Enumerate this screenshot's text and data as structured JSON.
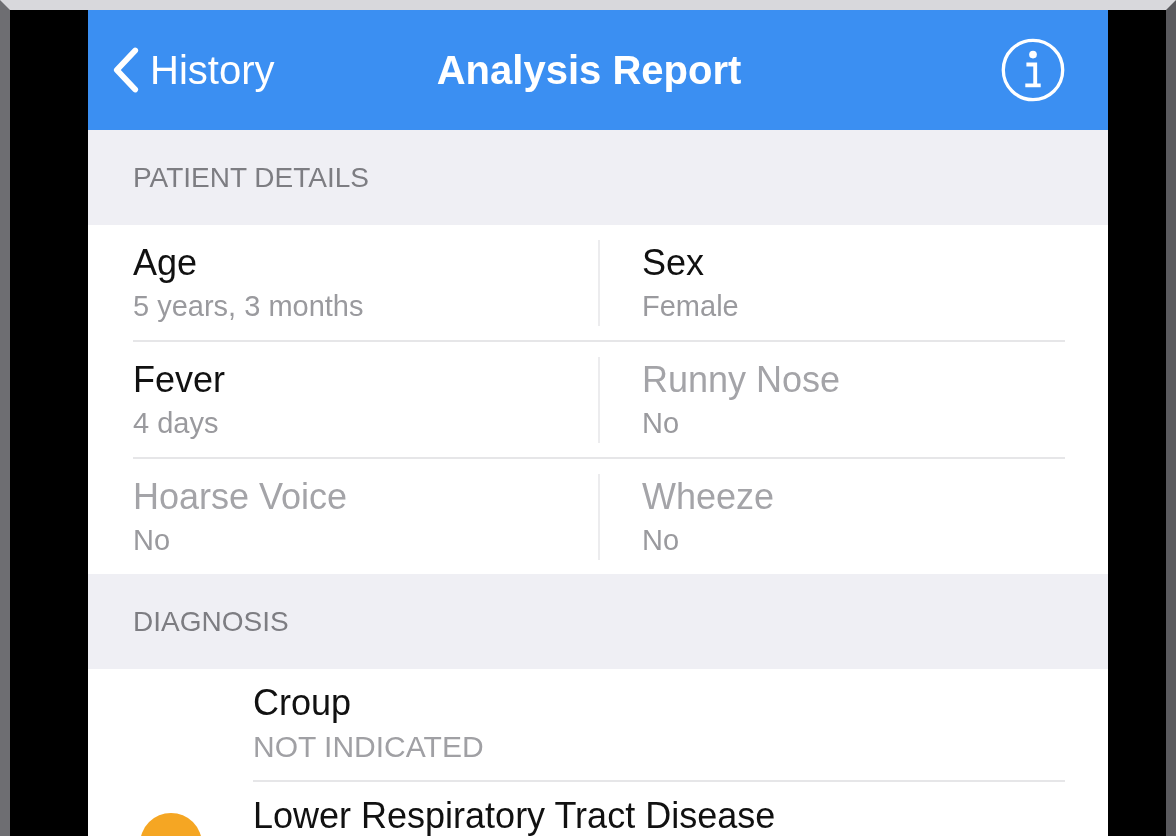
{
  "nav_bar": {
    "back_label": "History",
    "title": "Analysis Report"
  },
  "sections": [
    {
      "header": "PATIENT DETAILS",
      "rows": [
        [
          {
            "label": "Age",
            "value": "5 years, 3 months",
            "dimmed": false
          },
          {
            "label": "Sex",
            "value": "Female",
            "dimmed": false
          }
        ],
        [
          {
            "label": "Fever",
            "value": "4 days",
            "dimmed": false
          },
          {
            "label": "Runny Nose",
            "value": "No",
            "dimmed": true
          }
        ],
        [
          {
            "label": "Hoarse Voice",
            "value": "No",
            "dimmed": true
          },
          {
            "label": "Wheeze",
            "value": "No",
            "dimmed": true
          }
        ]
      ]
    }
  ],
  "diagnosis": {
    "header": "DIAGNOSIS",
    "items": [
      {
        "name": "Croup",
        "status": "NOT INDICATED",
        "flagged": false
      },
      {
        "name": "Lower Respiratory Tract Disease",
        "flagged": true,
        "color": "#f5a623"
      }
    ]
  }
}
